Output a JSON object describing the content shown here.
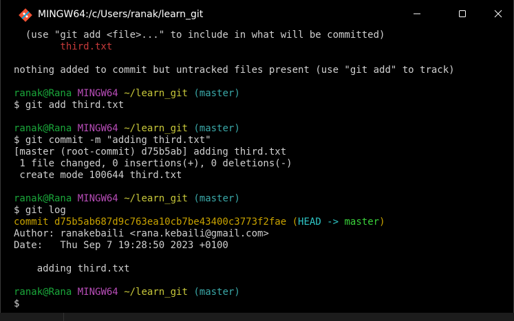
{
  "window": {
    "title": "MINGW64:/c/Users/ranak/learn_git",
    "icon": "git-bash-icon",
    "controls": {
      "minimize": "minimize-icon",
      "maximize": "maximize-icon",
      "close": "close-icon"
    }
  },
  "colors": {
    "background": "#000000",
    "text": "#c0c0c0",
    "prompt_user": "#1aa73a",
    "prompt_host": "#b84db8",
    "prompt_path": "#c8c83a",
    "prompt_branch": "#3aa8a8",
    "untracked_file": "#c83a3a",
    "commit_hash": "#c9a300",
    "head_ref": "#2ec7c7",
    "branch_ref": "#3ad13a"
  },
  "terminal": {
    "line1": "  (use \"git add <file>...\" to include in what will be committed)",
    "line2_file": "        third.txt",
    "line4": "nothing added to commit but untracked files present (use \"git add\" to track)",
    "prompt1": {
      "user": "ranak@Rana",
      "host": "MINGW64",
      "path": "~/learn_git",
      "branch": "(master)"
    },
    "cmd1": "$ git add third.txt",
    "prompt2": {
      "user": "ranak@Rana",
      "host": "MINGW64",
      "path": "~/learn_git",
      "branch": "(master)"
    },
    "cmd2": "$ git commit -m \"adding third.txt\"",
    "out2a": "[master (root-commit) d75b5ab] adding third.txt",
    "out2b": " 1 file changed, 0 insertions(+), 0 deletions(-)",
    "out2c": " create mode 100644 third.txt",
    "prompt3": {
      "user": "ranak@Rana",
      "host": "MINGW64",
      "path": "~/learn_git",
      "branch": "(master)"
    },
    "cmd3": "$ git log",
    "log": {
      "commit_label": "commit d75b5ab687d9c763ea10cb7be43400c3773f2fae",
      "paren_open": "(",
      "head": "HEAD ->",
      "branch": "master",
      "paren_close": ")",
      "author": "Author: ranakebaili <rana.kebaili@gmail.com>",
      "date": "Date:   Thu Sep 7 19:28:50 2023 +0100",
      "message": "    adding third.txt"
    },
    "prompt4": {
      "user": "ranak@Rana",
      "host": "MINGW64",
      "path": "~/learn_git",
      "branch": "(master)"
    },
    "cmd4": "$ "
  }
}
